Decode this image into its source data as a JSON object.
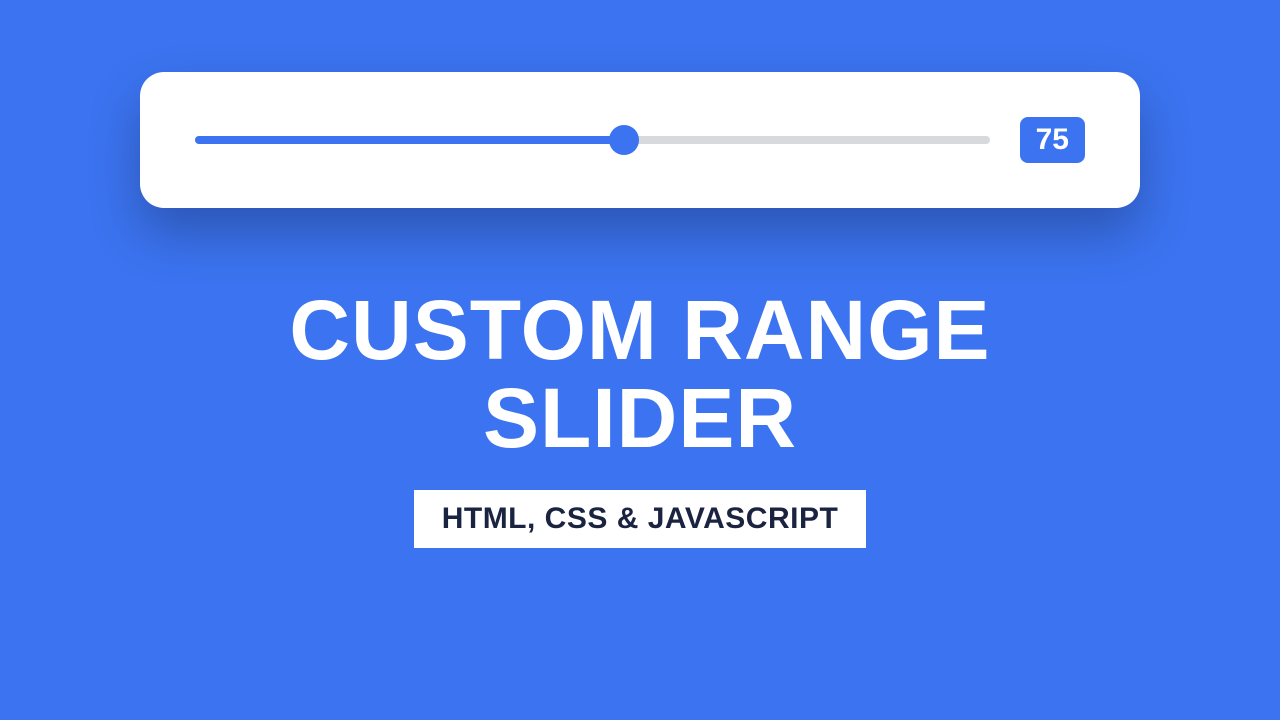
{
  "slider": {
    "value": 75,
    "min": 0,
    "max": 100,
    "display": "75"
  },
  "heading": "CUSTOM RANGE\nSLIDER",
  "subtitle": "HTML, CSS & JAVASCRIPT",
  "colors": {
    "accent": "#3b73f0",
    "card_bg": "#ffffff",
    "track_bg": "#d7d9dc"
  }
}
